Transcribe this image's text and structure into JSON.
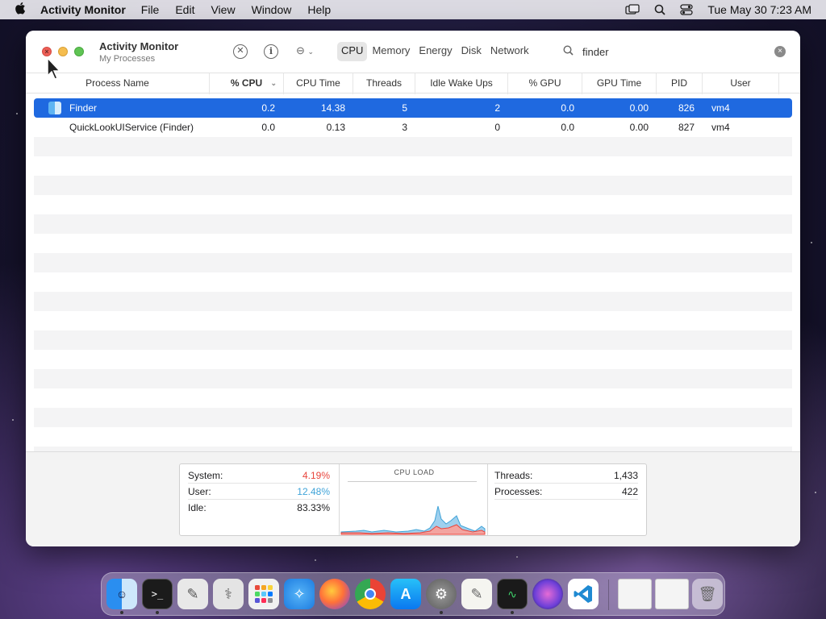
{
  "menubar": {
    "app_name": "Activity Monitor",
    "menus": [
      "File",
      "Edit",
      "View",
      "Window",
      "Help"
    ],
    "clock": "Tue May 30  7:23 AM"
  },
  "window": {
    "title": "Activity Monitor",
    "subtitle": "My Processes",
    "tabs": [
      "CPU",
      "Memory",
      "Energy",
      "Disk",
      "Network"
    ],
    "active_tab": "CPU",
    "search": {
      "value": "finder"
    }
  },
  "table": {
    "columns": [
      "Process Name",
      "% CPU",
      "CPU Time",
      "Threads",
      "Idle Wake Ups",
      "% GPU",
      "GPU Time",
      "PID",
      "User"
    ],
    "sorted_column": "% CPU",
    "rows": [
      {
        "name": "Finder",
        "cpu": "0.2",
        "cpu_time": "14.38",
        "threads": "5",
        "idle_wake_ups": "2",
        "gpu": "0.0",
        "gpu_time": "0.00",
        "pid": "826",
        "user": "vm4",
        "selected": true
      },
      {
        "name": "QuickLookUIService (Finder)",
        "cpu": "0.0",
        "cpu_time": "0.13",
        "threads": "3",
        "idle_wake_ups": "0",
        "gpu": "0.0",
        "gpu_time": "0.00",
        "pid": "827",
        "user": "vm4",
        "selected": false
      }
    ]
  },
  "footer": {
    "system_label": "System:",
    "system_value": "4.19%",
    "user_label": "User:",
    "user_value": "12.48%",
    "idle_label": "Idle:",
    "idle_value": "83.33%",
    "cpu_load_title": "CPU LOAD",
    "threads_label": "Threads:",
    "threads_value": "1,433",
    "processes_label": "Processes:",
    "processes_value": "422"
  },
  "colors": {
    "system": "#e8453c",
    "user": "#3fa3d8",
    "selection": "#1f69e0"
  },
  "dock": {
    "apps": [
      "finder-icon",
      "terminal-icon",
      "script-editor-icon",
      "disk-utility-icon",
      "launchpad-icon",
      "safari-icon",
      "firefox-icon",
      "chrome-icon",
      "app-store-icon",
      "system-preferences-icon",
      "textedit-icon",
      "activity-monitor-icon",
      "siri-icon",
      "vscode-icon",
      "window-thumbnail-icon",
      "window-thumbnail-icon",
      "trash-icon"
    ]
  }
}
